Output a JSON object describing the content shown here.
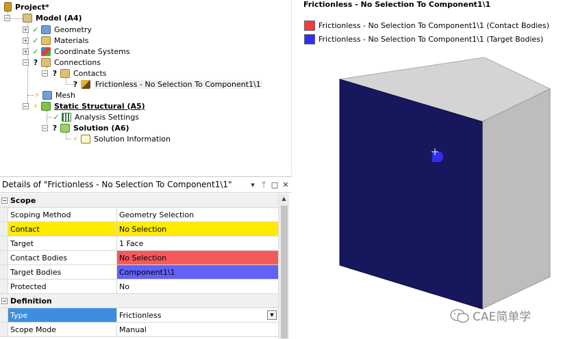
{
  "tree": {
    "project": "Project*",
    "model": "Model (A4)",
    "geometry": "Geometry",
    "materials": "Materials",
    "coordinate_systems": "Coordinate Systems",
    "connections": "Connections",
    "contacts": "Contacts",
    "contact_item": "Frictionless - No Selection To Component1\\1",
    "mesh": "Mesh",
    "static_structural": "Static Structural (A5)",
    "analysis_settings": "Analysis Settings",
    "solution": "Solution (A6)",
    "solution_information": "Solution Information",
    "expand_plus": "+",
    "expand_minus": "−",
    "status_check": "✓",
    "status_question": "?",
    "status_bolt": "⚡"
  },
  "details": {
    "title": "Details of \"Frictionless - No Selection To Component1\\1\"",
    "pin_glyph": "ᵖ",
    "buttons": {
      "dropdown": "▾",
      "pin": "ᛘ",
      "maximize": "□",
      "close": "✕"
    },
    "sections": {
      "scope": "Scope",
      "definition": "Definition"
    },
    "rows": {
      "scoping_method": {
        "label": "Scoping Method",
        "value": "Geometry Selection"
      },
      "contact": {
        "label": "Contact",
        "value": "No Selection"
      },
      "target": {
        "label": "Target",
        "value": "1 Face"
      },
      "contact_bodies": {
        "label": "Contact Bodies",
        "value": "No Selection"
      },
      "target_bodies": {
        "label": "Target Bodies",
        "value": "Component1\\1"
      },
      "protected": {
        "label": "Protected",
        "value": "No"
      },
      "type": {
        "label": "Type",
        "value": "Frictionless"
      },
      "scope_mode": {
        "label": "Scope Mode",
        "value": "Manual"
      }
    },
    "colors": {
      "highlight_yellow": "#ffeb00",
      "contact_red": "#f45a5a",
      "target_blue": "#6262f6",
      "selected_blue": "#3c8ee0"
    }
  },
  "graphics": {
    "title": "Frictionless - No Selection To Component1\\1",
    "legend": [
      {
        "label": "Frictionless - No Selection To Component1\\1 (Contact Bodies)",
        "color": "#f43a3a"
      },
      {
        "label": "Frictionless - No Selection To Component1\\1 (Target Bodies)",
        "color": "#2f2ff4"
      }
    ],
    "colors": {
      "front_face": "#17175e",
      "top_face": "#d4d4d4",
      "side_face": "#bdbdbd",
      "target_patch": "#2f2ff4"
    },
    "watermark": "CAE简单学"
  }
}
